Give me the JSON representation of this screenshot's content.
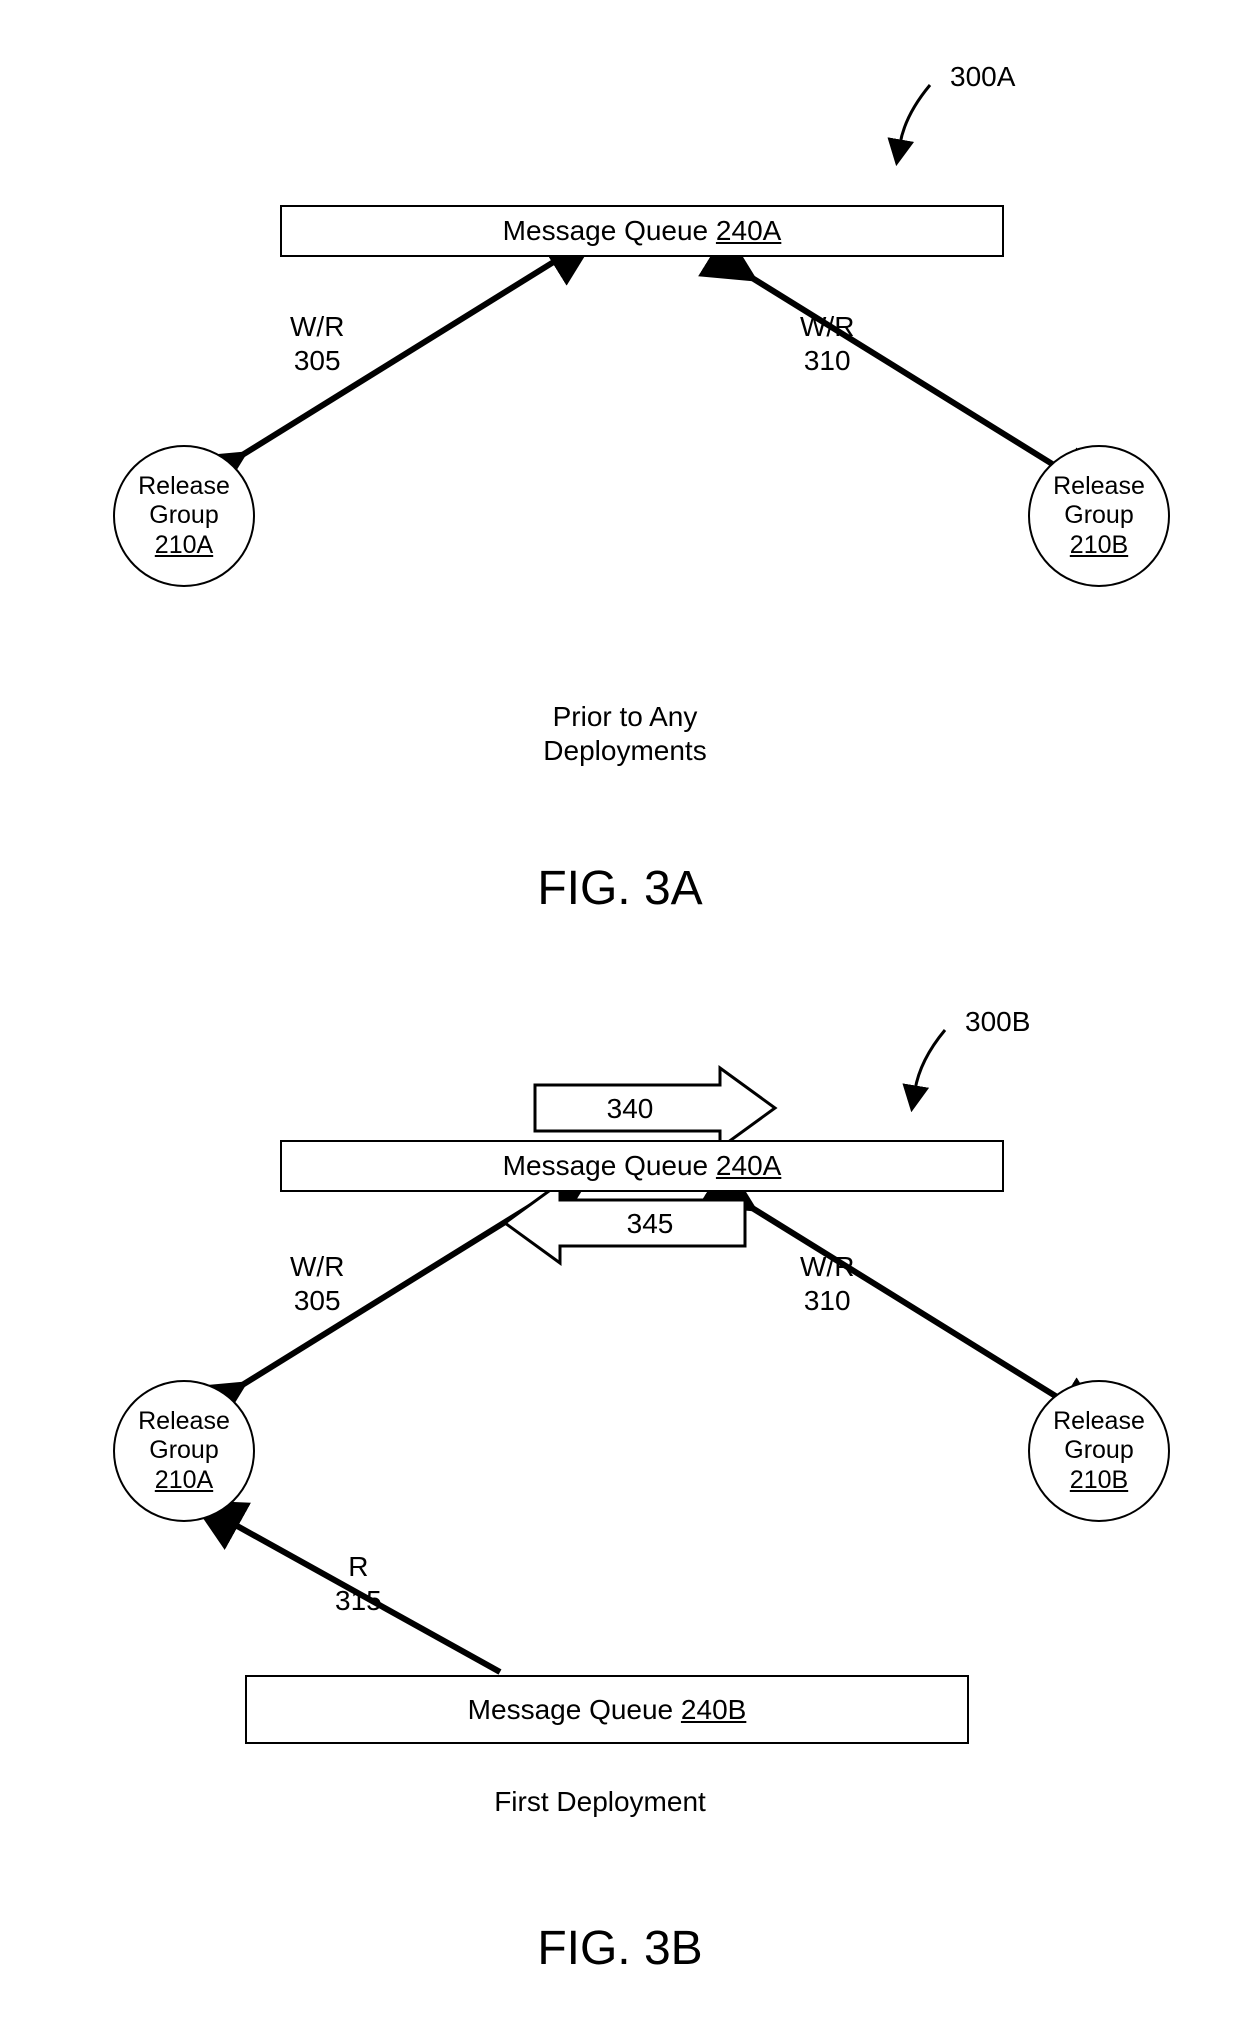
{
  "figA": {
    "ref_label": "300A",
    "queue_label_prefix": "Message Queue ",
    "queue_label_id": "240A",
    "wr_left_label": "W/R",
    "wr_left_num": "305",
    "wr_right_label": "W/R",
    "wr_right_num": "310",
    "group_left_line1": "Release",
    "group_left_line2": "Group",
    "group_left_id": "210A",
    "group_right_line1": "Release",
    "group_right_line2": "Group",
    "group_right_id": "210B",
    "caption_line1": "Prior to Any",
    "caption_line2": "Deployments",
    "fig_label": "FIG. 3A"
  },
  "figB": {
    "ref_label": "300B",
    "queue_top_label_prefix": "Message Queue ",
    "queue_top_label_id": "240A",
    "queue_bottom_label_prefix": "Message Queue ",
    "queue_bottom_label_id": "240B",
    "arrow_top_num": "340",
    "arrow_bottom_num": "345",
    "wr_left_label": "W/R",
    "wr_left_num": "305",
    "wr_right_label": "W/R",
    "wr_right_num": "310",
    "r_label": "R",
    "r_num": "315",
    "group_left_line1": "Release",
    "group_left_line2": "Group",
    "group_left_id": "210A",
    "group_right_line1": "Release",
    "group_right_line2": "Group",
    "group_right_id": "210B",
    "caption": "First Deployment",
    "fig_label": "FIG. 3B"
  }
}
